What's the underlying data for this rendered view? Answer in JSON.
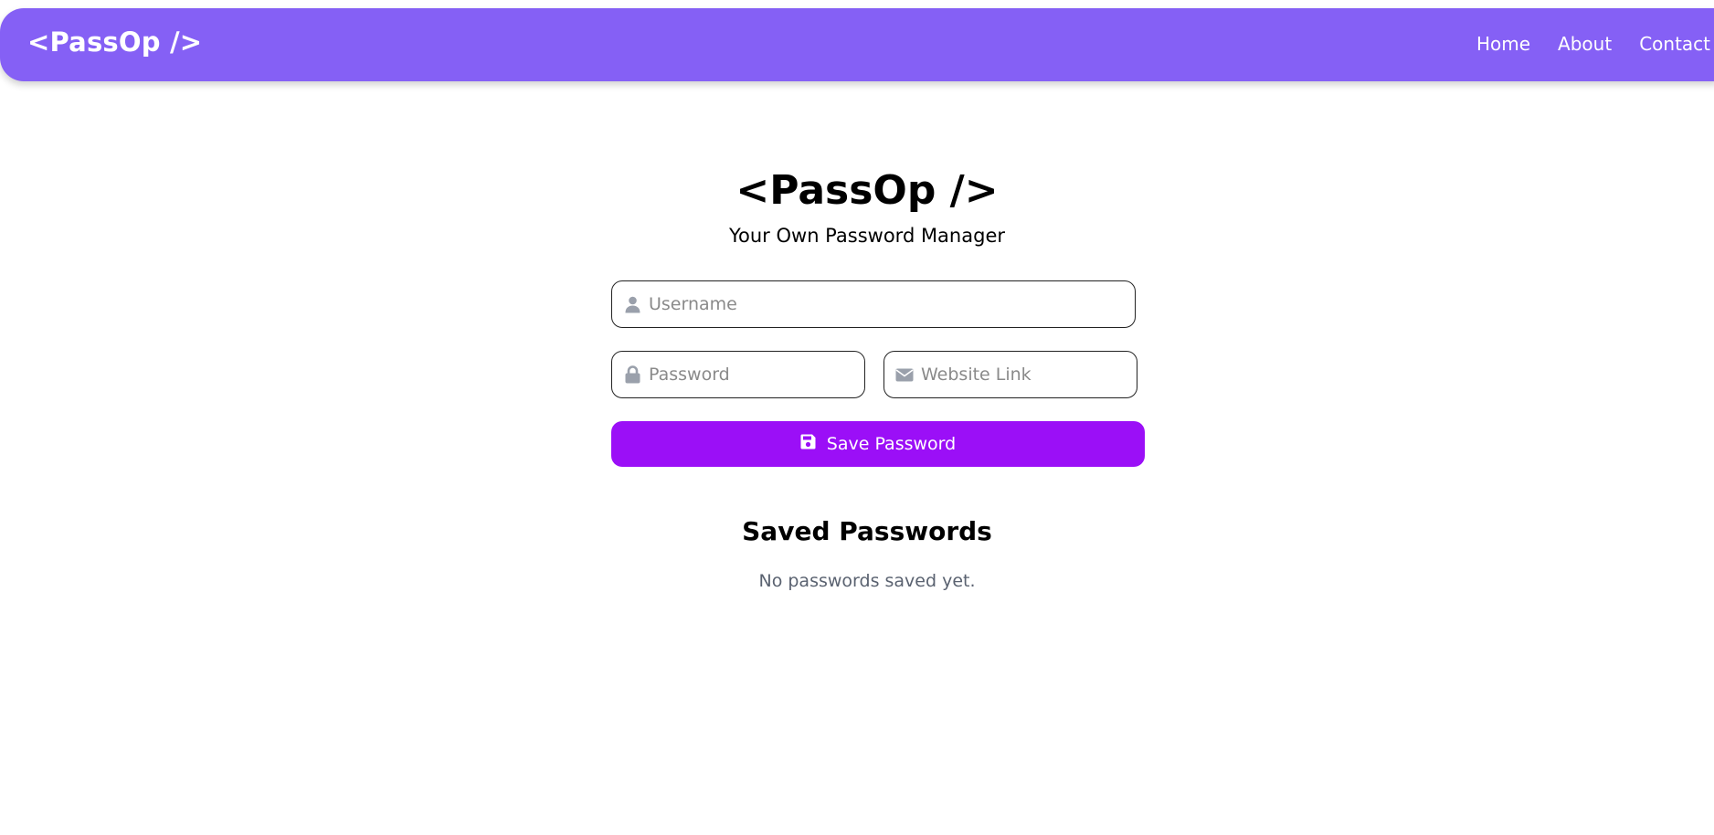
{
  "navbar": {
    "brand": "<PassOp />",
    "links": [
      "Home",
      "About",
      "Contact"
    ],
    "background_color": "#8560f5"
  },
  "hero": {
    "title": "<PassOp />",
    "subtitle": "Your Own Password Manager"
  },
  "form": {
    "username": {
      "placeholder": "Username",
      "value": "",
      "icon": "user-icon"
    },
    "password": {
      "placeholder": "Password",
      "value": "",
      "icon": "lock-icon"
    },
    "website": {
      "placeholder": "Website Link",
      "value": "",
      "icon": "envelope-icon"
    },
    "save_button": {
      "label": "Save Password",
      "icon": "floppy-disk-icon",
      "color": "#9b0ff7"
    }
  },
  "saved": {
    "title": "Saved Passwords",
    "empty_message": "No passwords saved yet."
  }
}
